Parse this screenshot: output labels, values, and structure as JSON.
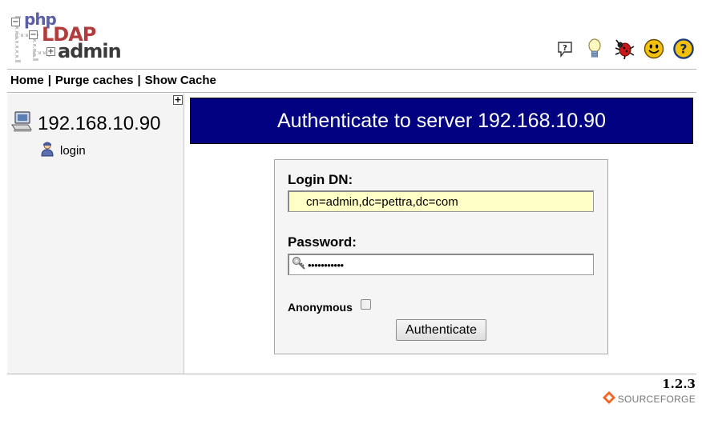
{
  "logo": {
    "php": "php",
    "ldap": "LDAP",
    "admin": "admin"
  },
  "header_icons": [
    "help-bubble-icon",
    "bulb-icon",
    "bug-icon",
    "smiley-icon",
    "question-icon"
  ],
  "topnav": {
    "home": "Home",
    "purge": "Purge caches",
    "show_cache": "Show Cache",
    "separator": "|"
  },
  "tree": {
    "expand_glyph": "+",
    "server": "192.168.10.90",
    "login": "login"
  },
  "main": {
    "banner_title": "Authenticate to server 192.168.10.90",
    "login_dn_label": "Login DN:",
    "login_dn_value": "cn=admin,dc=pettra,dc=com",
    "password_label": "Password:",
    "password_mask": "•••••••••••",
    "anonymous_label": "Anonymous",
    "anonymous_checked": false,
    "submit_label": "Authenticate"
  },
  "footer": {
    "version": "1.2.3",
    "sourceforge": "SOURCEFORGE"
  },
  "colors": {
    "banner": "#010181",
    "dn_field": "#ffffc6",
    "pane": "#f4f4f4",
    "logo_php": "#5b5fa6",
    "logo_ldap": "#b23b3b"
  }
}
